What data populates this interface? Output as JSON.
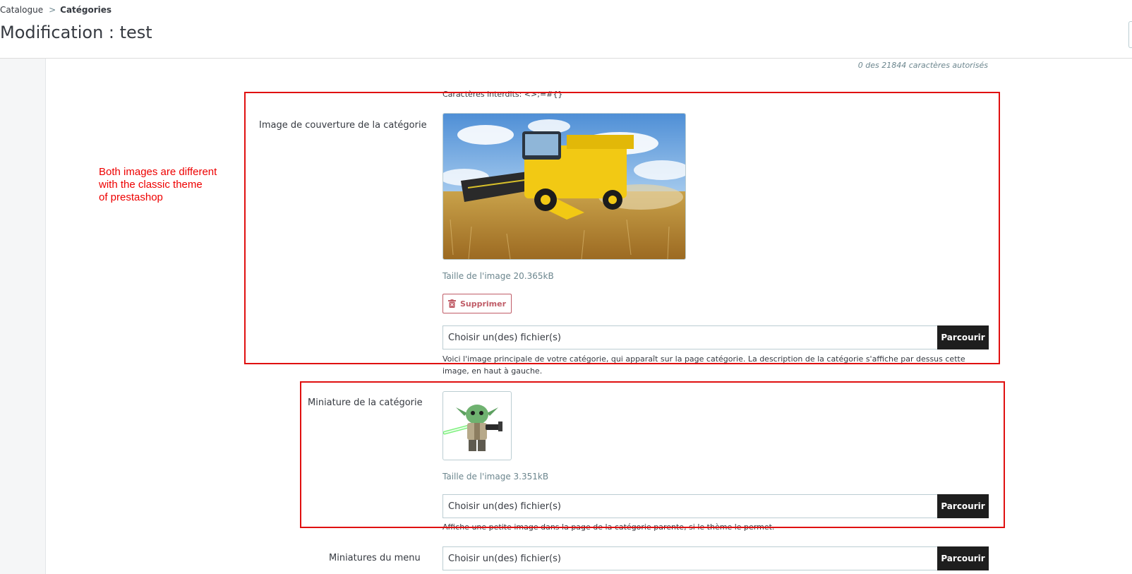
{
  "breadcrumb": {
    "parent": "Catalogue",
    "separator": ">",
    "current": "Catégories"
  },
  "page_title": "Modification : test",
  "description_counter": "0 des 21844 caractères autorisés",
  "forbidden_chars_help": "Caractères interdits: <>;=#{}",
  "cover_image": {
    "label": "Image de couverture de la catégorie",
    "image_icon": "combine-harvester-photo",
    "size_text": "Taille de l'image 20.365kB",
    "delete_label": "Supprimer",
    "delete_icon": "trash-icon",
    "file_placeholder": "Choisir un(des) fichier(s)",
    "browse_label": "Parcourir",
    "help": "Voici l'image principale de votre catégorie, qui apparaît sur la page catégorie. La description de la catégorie s'affiche par dessus cette image, en haut à gauche."
  },
  "thumbnail": {
    "label": "Miniature de la catégorie",
    "image_icon": "yoda-lego-figure",
    "size_text": "Taille de l'image 3.351kB",
    "file_placeholder": "Choisir un(des) fichier(s)",
    "browse_label": "Parcourir",
    "help": "Affiche une petite image dans la page de la catégorie parente, si le thème le permet."
  },
  "menu_thumbnails": {
    "label": "Miniatures du menu",
    "file_placeholder": "Choisir un(des) fichier(s)",
    "browse_label": "Parcourir"
  },
  "annotation": "Both images are different\nwith the classic theme\nof prestashop",
  "colors": {
    "annotation_red": "#e01010",
    "browse_bg": "#1e1e1e",
    "delete_red": "#c05c67",
    "muted": "#6c868e"
  }
}
